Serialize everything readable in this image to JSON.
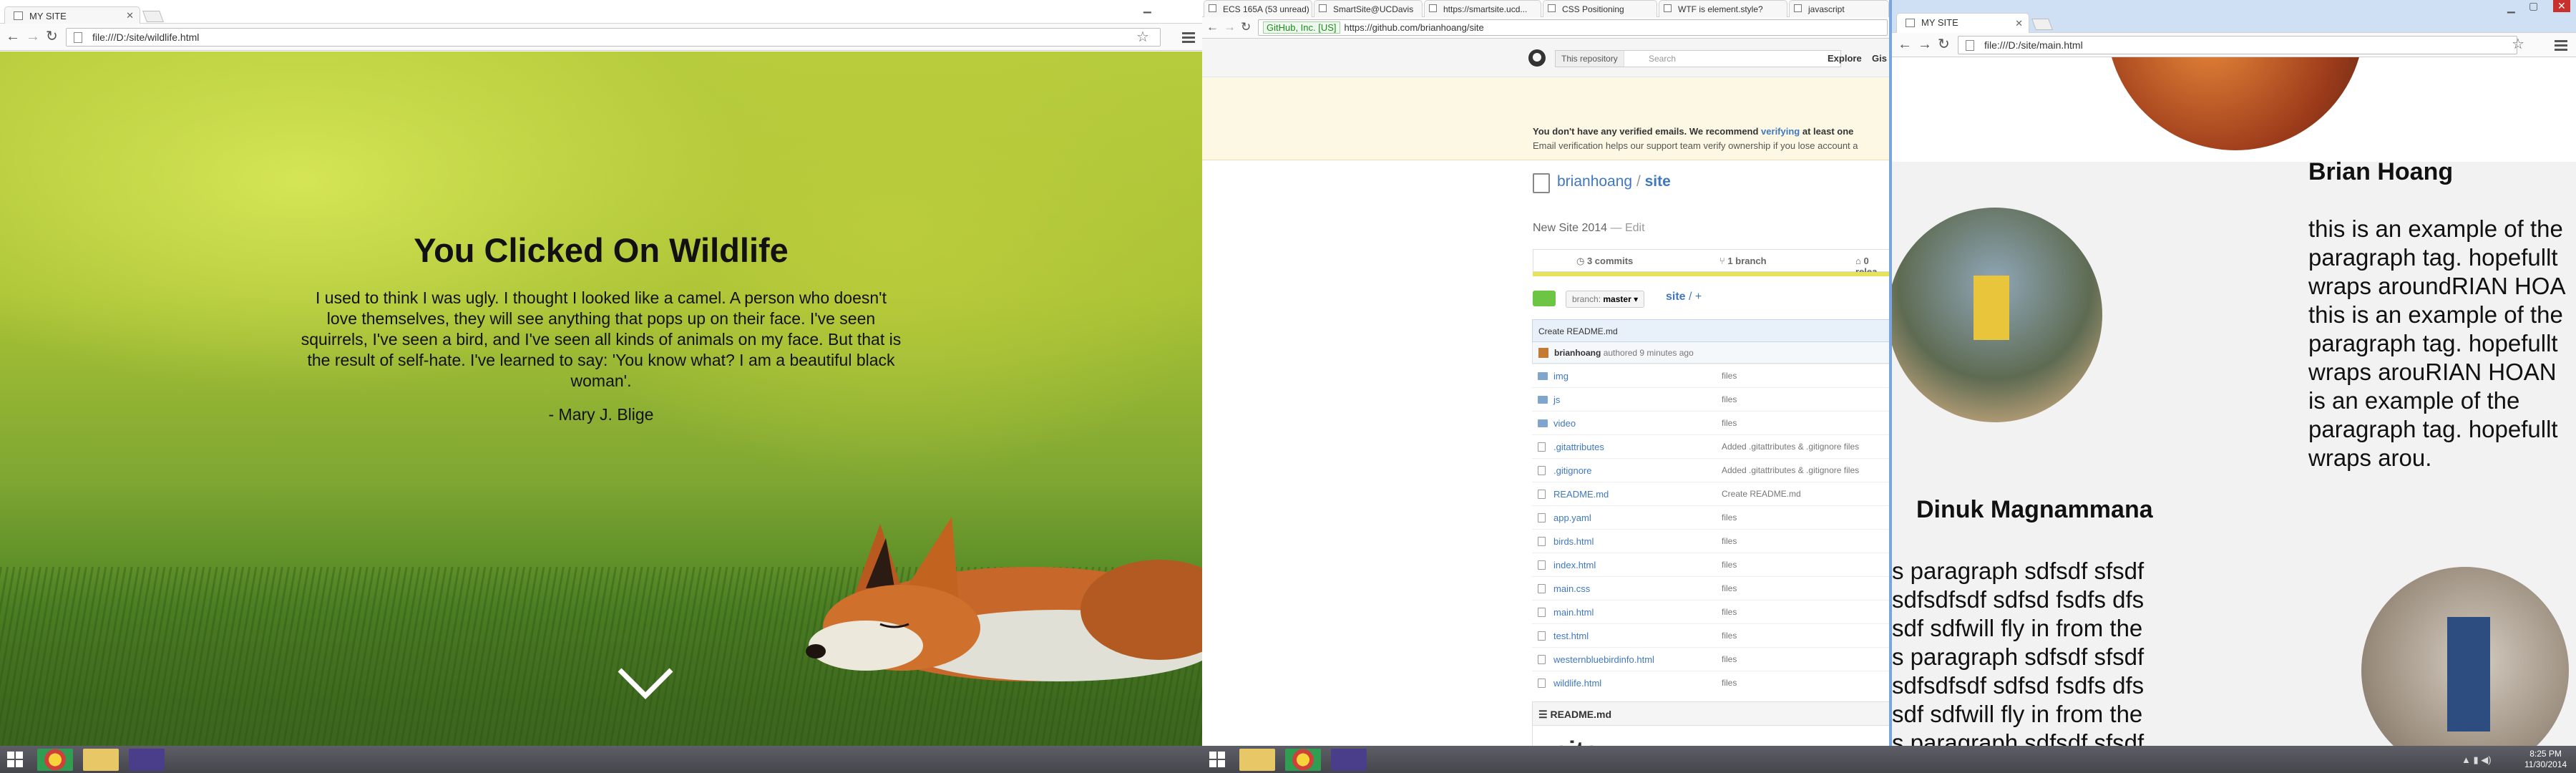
{
  "left_window": {
    "tab_title": "MY SITE",
    "url": "file:///D:/site/wildlife.html",
    "heading": "You Clicked On Wildlife",
    "quote": "I used to think I was ugly. I thought I looked like a camel. A person who doesn't love themselves, they will see anything that pops up on their face. I've seen squirrels, I've seen a bird, and I've seen all kinds of animals on my face. But that is the result of self-hate. I've learned to say: 'You know what? I am a beautiful black woman'.",
    "author": "- Mary J. Blige"
  },
  "middle_window": {
    "tabs": [
      "ECS 165A (53 unread)",
      "SmartSite@UCDavis",
      "https://smartsite.ucd...",
      "CSS Positioning",
      "WTF is element.style?",
      "javascript"
    ],
    "security_badge": "GitHub, Inc. [US]",
    "url": "https://github.com/brianhoang/site",
    "search_scope": "This repository",
    "search_placeholder": "Search",
    "nav": [
      "Explore",
      "Gis"
    ],
    "banner_line1_a": "You don't have any verified emails. We recommend ",
    "banner_line1_link": "verifying",
    "banner_line1_b": " at least one",
    "banner_line2": "Email verification helps our support team verify ownership if you lose account a",
    "owner": "brianhoang",
    "separator": "/",
    "repo": "site",
    "description": "New Site 2014",
    "edit_label": "— Edit",
    "stats": [
      "3 commits",
      "1 branch",
      "0 relea"
    ],
    "branch_label": "branch:",
    "branch_name": "master",
    "path_repo": "site",
    "path_sep": "/ +",
    "commit_title": "Create README.md",
    "commit_author": "brianhoang",
    "commit_time": "authored 9 minutes ago",
    "files": [
      {
        "name": "img",
        "msg": "files",
        "type": "dir"
      },
      {
        "name": "js",
        "msg": "files",
        "type": "dir"
      },
      {
        "name": "video",
        "msg": "files",
        "type": "dir"
      },
      {
        "name": ".gitattributes",
        "msg": "Added .gitattributes & .gitignore files",
        "type": "file"
      },
      {
        "name": ".gitignore",
        "msg": "Added .gitattributes & .gitignore files",
        "type": "file"
      },
      {
        "name": "README.md",
        "msg": "Create README.md",
        "type": "file"
      },
      {
        "name": "app.yaml",
        "msg": "files",
        "type": "file"
      },
      {
        "name": "birds.html",
        "msg": "files",
        "type": "file"
      },
      {
        "name": "index.html",
        "msg": "files",
        "type": "file"
      },
      {
        "name": "main.css",
        "msg": "files",
        "type": "file"
      },
      {
        "name": "main.html",
        "msg": "files",
        "type": "file"
      },
      {
        "name": "test.html",
        "msg": "files",
        "type": "file"
      },
      {
        "name": "westernbluebirdinfo.html",
        "msg": "files",
        "type": "file"
      },
      {
        "name": "wildlife.html",
        "msg": "files",
        "type": "file"
      }
    ],
    "readme_header": "README.md",
    "readme_title": "site"
  },
  "right_window": {
    "tab_title": "MY SITE",
    "url": "file:///D:/site/main.html",
    "person1_name": "Brian Hoang",
    "person1_lines": [
      "this is an example of the",
      "paragraph tag. hopefullt",
      "wraps aroundRIAN HOA",
      "this is an example of the",
      "paragraph tag. hopefullt",
      "wraps arouRIAN HOAN",
      "is an example of the",
      "paragraph tag. hopefullt",
      "wraps arou."
    ],
    "person2_name": "Dinuk Magnammana",
    "person2_lines": [
      "s paragraph sdfsdf sfsdf",
      "sdfsdfsdf sdfsd fsdfs dfs",
      "sdf sdfwill fly in from the",
      "s paragraph sdfsdf sfsdf",
      "sdfsdfsdf sdfsd fsdfs dfs",
      "sdf sdfwill fly in from the",
      "s paragraph sdfsdf sfsdf"
    ]
  },
  "taskbar": {
    "time": "8:25 PM",
    "date": "11/30/2014"
  }
}
